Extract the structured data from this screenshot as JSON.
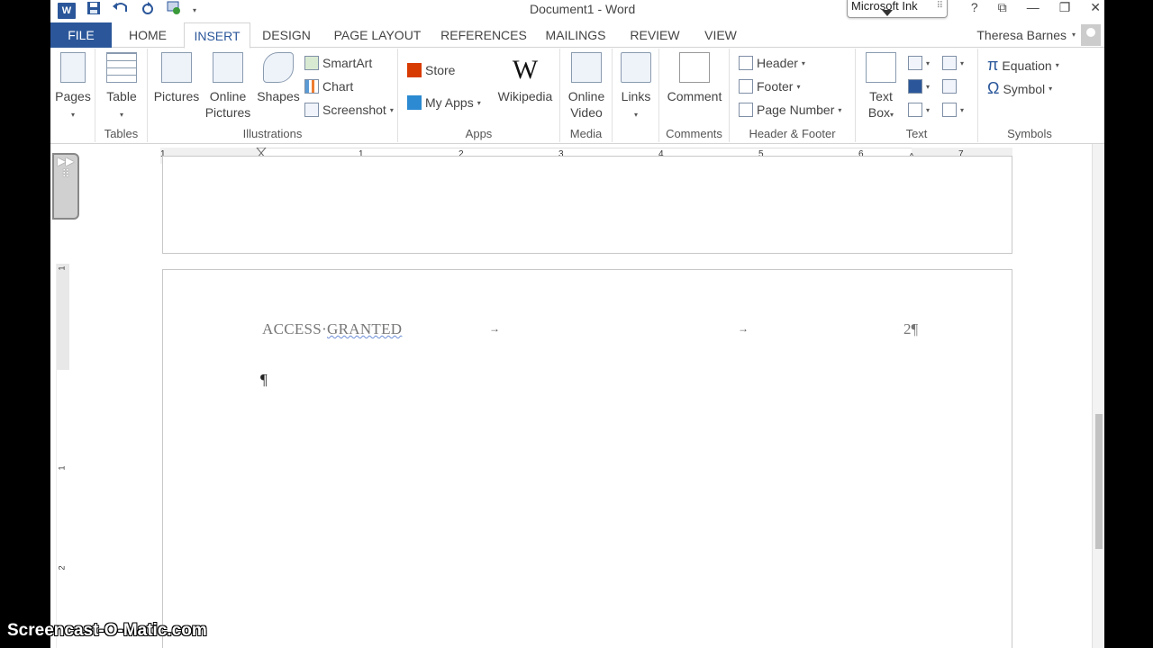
{
  "titlebar": {
    "app_logo": "W",
    "doc_title": "Document1 - Word",
    "ink_panel": "Microsoft Ink",
    "controls": {
      "help": "?",
      "ribbon_options": "⧉",
      "minimize": "—",
      "restore": "❐",
      "close": "✕"
    }
  },
  "tabs": [
    {
      "label": "FILE"
    },
    {
      "label": "HOME"
    },
    {
      "label": "INSERT"
    },
    {
      "label": "DESIGN"
    },
    {
      "label": "PAGE LAYOUT"
    },
    {
      "label": "REFERENCES"
    },
    {
      "label": "MAILINGS"
    },
    {
      "label": "REVIEW"
    },
    {
      "label": "VIEW"
    }
  ],
  "active_tab": "INSERT",
  "user": {
    "name": "Theresa Barnes"
  },
  "ribbon": {
    "pages": {
      "label": "Pages"
    },
    "tables": {
      "label": "Table",
      "group": "Tables"
    },
    "illustrations": {
      "pictures": "Pictures",
      "online_pictures_1": "Online",
      "online_pictures_2": "Pictures",
      "shapes": "Shapes",
      "smartart": "SmartArt",
      "chart": "Chart",
      "screenshot": "Screenshot",
      "group": "Illustrations"
    },
    "apps": {
      "store": "Store",
      "my_apps": "My Apps",
      "wikipedia": "Wikipedia",
      "wiki_logo": "W",
      "group": "Apps"
    },
    "media": {
      "online_1": "Online",
      "online_2": "Video",
      "group": "Media"
    },
    "links": {
      "label": "Links"
    },
    "comments": {
      "label": "Comment",
      "group": "Comments"
    },
    "header_footer": {
      "header": "Header",
      "footer": "Footer",
      "page_number": "Page Number",
      "group": "Header & Footer"
    },
    "text": {
      "textbox_1": "Text",
      "textbox_2": "Box",
      "group": "Text"
    },
    "symbols": {
      "equation": "Equation",
      "symbol": "Symbol",
      "group": "Symbols"
    }
  },
  "ruler": {
    "marks": [
      "1",
      "1",
      "2",
      "3",
      "4",
      "5",
      "6",
      "7"
    ]
  },
  "vruler": {
    "marks": [
      "1",
      "1",
      "2"
    ]
  },
  "document": {
    "header_text_1": "ACCESS",
    "header_text_2": "GRANTED",
    "tab_arrow": "→",
    "page_number": "2¶",
    "cursor_mark": "¶"
  },
  "watermark": "Screencast-O-Matic.com"
}
